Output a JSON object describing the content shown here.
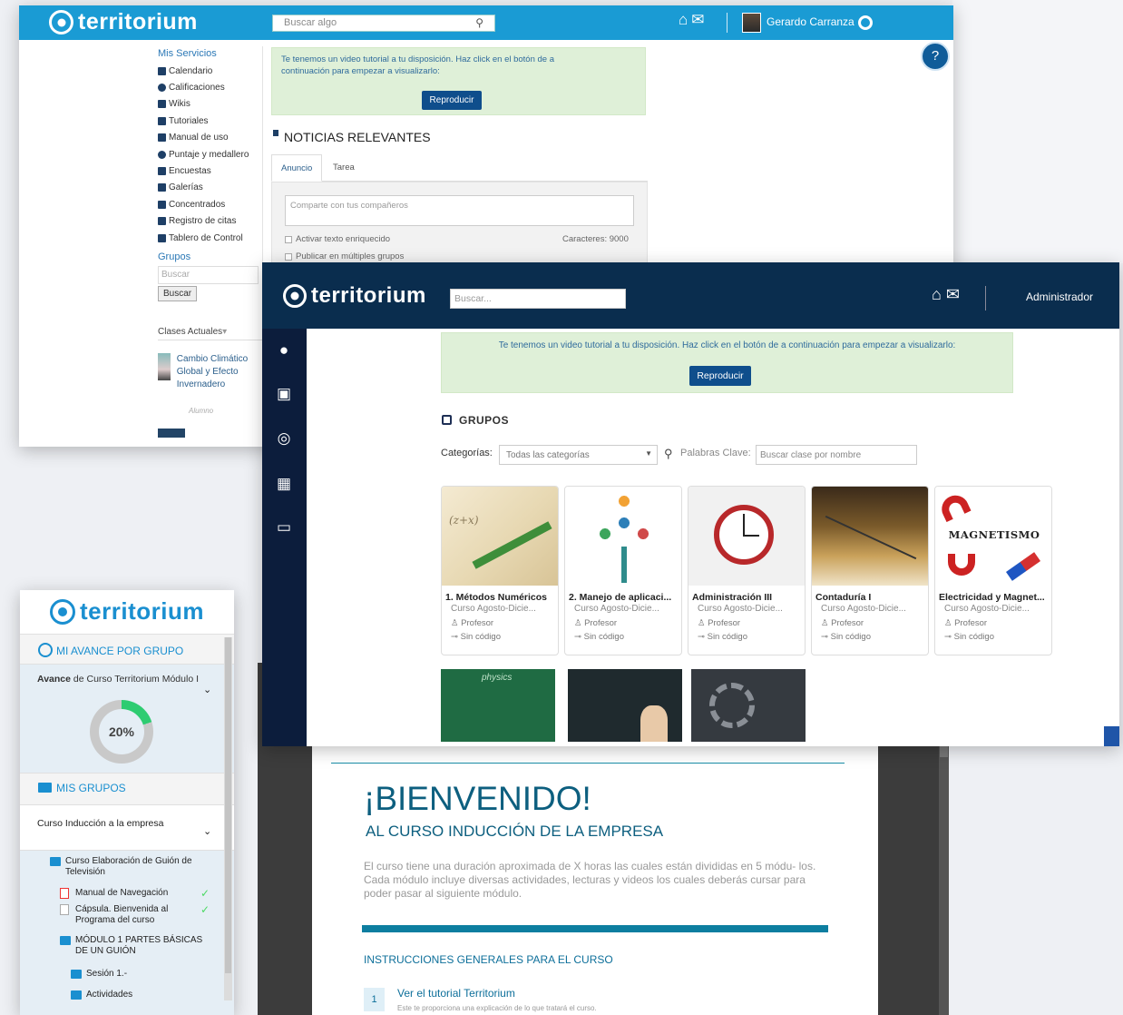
{
  "brand": {
    "name": "territorium",
    "color": "#1a9bd4",
    "navy": "#0a2d4e"
  },
  "w1": {
    "search_placeholder": "Buscar algo",
    "user_name": "Gerardo Carranza",
    "help": "?",
    "services_title": "Mis Servicios",
    "services": [
      "Calendario",
      "Calificaciones",
      "Wikis",
      "Tutoriales",
      "Manual de uso",
      "Puntaje y medallero",
      "Encuestas",
      "Galerías",
      "Concentrados",
      "Registro de citas",
      "Tablero de Control"
    ],
    "groups_title": "Grupos",
    "groups_search_placeholder": "Buscar",
    "groups_search_button": "Buscar",
    "classes_title": "Clases Actuales",
    "course_title": "Cambio Climático Global y Efecto Invernadero",
    "course_role": "Alumno",
    "tutorial_text": "Te tenemos un video tutorial a tu disposición. Haz click en el botón de a continuación para empezar a visualizarlo:",
    "play_button": "Reproducir",
    "news_title": "NOTICIAS RELEVANTES",
    "tabs": [
      "Anuncio",
      "Tarea"
    ],
    "share_placeholder": "Comparte con tus compañeros",
    "rich_text_label": "Activar texto enriquecido",
    "multi_groups_label": "Publicar en múltiples grupos",
    "chars_label": "Caracteres:  9000"
  },
  "w2": {
    "search_placeholder": "Buscar...",
    "user_name": "Administrador",
    "tutorial_text": "Te tenemos un video tutorial a tu disposición. Haz click en el botón de a continuación para empezar a visualizarlo:",
    "play_button": "Reproducir",
    "groups_title": "GRUPOS",
    "categories_label": "Categorías:",
    "categories_value": "Todas las categorías",
    "keywords_label": "Palabras Clave:",
    "keywords_placeholder": "Buscar clase por nombre",
    "cards": [
      {
        "title": "1. Métodos Numéricos",
        "subtitle": "Curso Agosto-Dicie...",
        "role": "Profesor",
        "code": "Sin código"
      },
      {
        "title": "2. Manejo de aplicaci...",
        "subtitle": "Curso Agosto-Dicie...",
        "role": "Profesor",
        "code": "Sin código"
      },
      {
        "title": "Administración III",
        "subtitle": "Curso Agosto-Dicie...",
        "role": "Profesor",
        "code": "Sin código"
      },
      {
        "title": "Contaduría I",
        "subtitle": "Curso Agosto-Dicie...",
        "role": "Profesor",
        "code": "Sin código"
      },
      {
        "title": "Electricidad y Magnet...",
        "subtitle": "Curso Agosto-Dicie...",
        "role": "Profesor",
        "code": "Sin código",
        "image_text": "MAGNETISMO"
      }
    ],
    "second_row_image_text": "physics"
  },
  "w3": {
    "progress_header": "MI AVANCE POR GRUPO",
    "progress_title_bold": "Avance",
    "progress_title_rest": " de Curso Territorium Módulo I",
    "progress_value": "20%",
    "progress_fraction": 0.2,
    "groups_header": "MIS GRUPOS",
    "group_name": "Curso Inducción a la empresa",
    "tree": [
      {
        "label": "Curso Elaboración de Guión de Televisión",
        "type": "folder"
      },
      {
        "label": "Manual de Navegación",
        "type": "pdf",
        "done": true
      },
      {
        "label": "Cápsula. Bienvenida al Programa del curso",
        "type": "doc",
        "done": true
      },
      {
        "label": "MÓDULO 1 PARTES BÁSICAS DE UN GUIÓN",
        "type": "folder"
      },
      {
        "label": "Sesión 1.-",
        "type": "folder"
      },
      {
        "label": "Actividades",
        "type": "folder"
      }
    ]
  },
  "w4": {
    "welcome": "¡BIENVENIDO!",
    "subtitle": "AL CURSO INDUCCIÓN DE LA EMPRESA",
    "paragraph1": "El curso tiene una duración aproximada de X horas las cuales están divididas en 5 módu- los.",
    "paragraph2": "Cada módulo incluye diversas actividades, lecturas y videos los cuales deberás cursar para poder pasar al siguiente módulo.",
    "instructions_title": "INSTRUCCIONES GENERALES PARA EL CURSO",
    "step_number": "1",
    "step_title": "Ver el tutorial Territorium",
    "step_desc": "Este te proporciona una explicación de lo que tratará el curso."
  }
}
